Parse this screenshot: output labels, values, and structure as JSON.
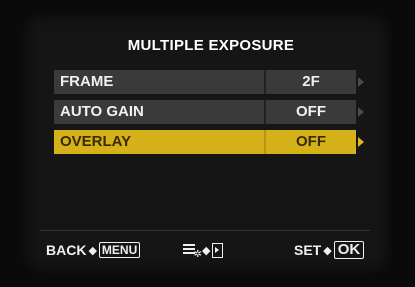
{
  "title": "MULTIPLE EXPOSURE",
  "items": [
    {
      "label": "FRAME",
      "value": "2F",
      "selected": false
    },
    {
      "label": "AUTO GAIN",
      "value": "OFF",
      "selected": false
    },
    {
      "label": "OVERLAY",
      "value": "OFF",
      "selected": true
    }
  ],
  "footer": {
    "back_label": "BACK",
    "back_key": "MENU",
    "set_label": "SET",
    "set_key": "OK",
    "arrow": "◆"
  },
  "colors": {
    "highlight": "#d6b21a",
    "row_bg": "#3a3a3a",
    "text": "#f0f0f0"
  },
  "icons": {
    "menu_settings": "menu-settings-icon",
    "right_arrow_box": "right-arrow-box-icon"
  }
}
